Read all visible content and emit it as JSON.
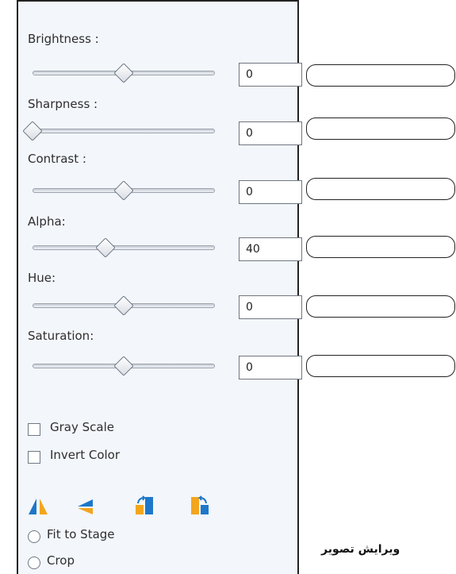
{
  "adjustments": [
    {
      "label": "Brightness :",
      "value": "0",
      "level": 0.5
    },
    {
      "label": "Sharpness :",
      "value": "0",
      "level": 0.0
    },
    {
      "label": "Contrast :",
      "value": "0",
      "level": 0.5
    },
    {
      "label": "Alpha:",
      "value": "40",
      "level": 0.4
    },
    {
      "label": "Hue:",
      "value": "0",
      "level": 0.5
    },
    {
      "label": "Saturation:",
      "value": "0",
      "level": 0.5
    }
  ],
  "checkboxes": {
    "gray_scale": "Gray Scale",
    "invert_color": "Invert Color"
  },
  "transform_icons": [
    "flip-horizontal-icon",
    "flip-vertical-icon",
    "rotate-left-icon",
    "rotate-right-icon"
  ],
  "radios": {
    "fit_to_stage": "Fit to Stage",
    "crop": "Crop"
  },
  "caption": "ویرایش تصویر",
  "colors": {
    "icon_blue": "#1e77c9",
    "icon_orange": "#f3a51d"
  }
}
